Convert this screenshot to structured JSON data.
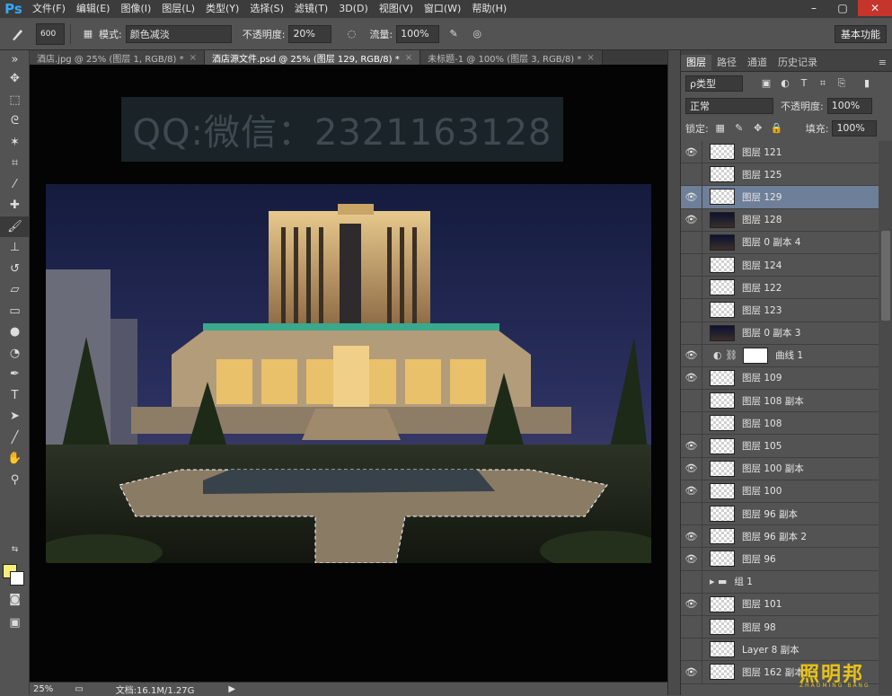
{
  "app": {
    "logo": "Ps"
  },
  "menu": [
    "文件(F)",
    "编辑(E)",
    "图像(I)",
    "图层(L)",
    "类型(Y)",
    "选择(S)",
    "滤镜(T)",
    "3D(D)",
    "视图(V)",
    "窗口(W)",
    "帮助(H)"
  ],
  "window_controls": {
    "minimize": "–",
    "maximize": "▢",
    "close": "✕"
  },
  "options": {
    "brush_size": "600",
    "mode_label": "模式:",
    "mode_value": "颜色减淡",
    "opacity_label": "不透明度:",
    "opacity_value": "20%",
    "flow_label": "流量:",
    "flow_value": "100%",
    "workspace": "基本功能"
  },
  "tabs": [
    {
      "label": "酒店.jpg @ 25% (图层 1, RGB/8) *",
      "close": "×"
    },
    {
      "label": "酒店源文件.psd @ 25% (图层 129, RGB/8) *",
      "close": "×"
    },
    {
      "label": "未标题-1 @ 100% (图层 3, RGB/8) *",
      "close": "×"
    }
  ],
  "canvas": {
    "watermark": "QQ:微信：2321163128"
  },
  "status": {
    "zoom": "25%",
    "doc": "文档:16.1M/1.27G"
  },
  "panel": {
    "tabs": [
      "图层",
      "路径",
      "通道",
      "历史记录"
    ],
    "filter_kind": "ρ类型",
    "blend_mode": "正常",
    "opacity_label": "不透明度:",
    "opacity_value": "100%",
    "lock_label": "锁定:",
    "fill_label": "填充:",
    "fill_value": "100%"
  },
  "layers": [
    {
      "name": "图层 121",
      "visible": true
    },
    {
      "name": "图层 125",
      "visible": false
    },
    {
      "name": "图层 129",
      "visible": true,
      "selected": true
    },
    {
      "name": "图层 128",
      "visible": true
    },
    {
      "name": "图层 0 副本 4",
      "visible": false
    },
    {
      "name": "图层 124",
      "visible": false
    },
    {
      "name": "图层 122",
      "visible": false
    },
    {
      "name": "图层 123",
      "visible": false
    },
    {
      "name": "图层 0 副本 3",
      "visible": false
    },
    {
      "name": "曲线 1",
      "visible": true,
      "type": "adjustment"
    },
    {
      "name": "图层 109",
      "visible": true
    },
    {
      "name": "图层 108 副本",
      "visible": false
    },
    {
      "name": "图层 108",
      "visible": false
    },
    {
      "name": "图层 105",
      "visible": true
    },
    {
      "name": "图层 100 副本",
      "visible": true
    },
    {
      "name": "图层 100",
      "visible": true
    },
    {
      "name": "图层 96 副本",
      "visible": false
    },
    {
      "name": "图层 96 副本 2",
      "visible": true
    },
    {
      "name": "图层 96",
      "visible": true
    },
    {
      "name": "组 1",
      "visible": false,
      "type": "group"
    },
    {
      "name": "图层 101",
      "visible": true
    },
    {
      "name": "图层 98",
      "visible": false
    },
    {
      "name": "Layer 8 副本",
      "visible": false
    },
    {
      "name": "图层 162 副本",
      "visible": true
    }
  ],
  "brand": {
    "name": "照明邦",
    "sub": "ZHAOMING BANG"
  },
  "colors": {
    "foreground": "#f7ee7a",
    "background": "#ffffff",
    "selected_layer": "#6e7f9a"
  }
}
